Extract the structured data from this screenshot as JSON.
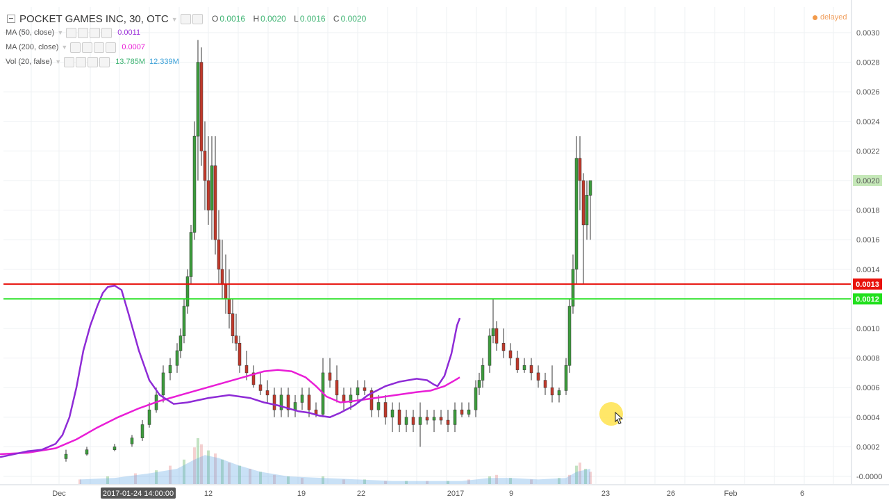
{
  "header": {
    "symbol_title": "POCKET GAMES INC, 30, OTC",
    "ohlc": {
      "o_label": "O",
      "o_value": "0.0016",
      "h_label": "H",
      "h_value": "0.0020",
      "l_label": "L",
      "l_value": "0.0016",
      "c_label": "C",
      "c_value": "0.0020"
    },
    "status": "delayed"
  },
  "indicators": {
    "ma50": {
      "label": "MA (50, close)",
      "value": "0.0011"
    },
    "ma200": {
      "label": "MA (200, close)",
      "value": "0.0007"
    },
    "volume": {
      "label": "Vol (20, false)",
      "value1": "13.785M",
      "value2": "12.339M"
    }
  },
  "chart_data": {
    "type": "candlestick",
    "x_tick_labels": [
      "Dec",
      "12",
      "19",
      "22",
      "2017",
      "9",
      "23",
      "26",
      "Feb",
      "6"
    ],
    "crosshair_x_label": "2017-01-24 14:00:00",
    "y_tick_labels": [
      "0.0030",
      "0.0028",
      "0.0026",
      "0.0024",
      "0.0022",
      "0.0020",
      "0.0018",
      "0.0016",
      "0.0014",
      "0.0010",
      "0.0008",
      "0.0006",
      "0.0004",
      "0.0002",
      "-0.0000"
    ],
    "ylim": [
      0.0,
      0.0031
    ],
    "last_price_label": "0.0020",
    "horizontal_lines": [
      {
        "name": "resistance",
        "value": 0.0013,
        "label": "0.0013",
        "color": "#e8120c"
      },
      {
        "name": "support",
        "value": 0.0012,
        "label": "0.0012",
        "color": "#22e01e"
      }
    ],
    "ma50_path": [
      [
        0,
        0.00013
      ],
      [
        20,
        0.00015
      ],
      [
        40,
        0.00017
      ],
      [
        60,
        0.00018
      ],
      [
        80,
        0.00022
      ],
      [
        90,
        0.00028
      ],
      [
        100,
        0.0004
      ],
      [
        110,
        0.0006
      ],
      [
        120,
        0.00085
      ],
      [
        130,
        0.00102
      ],
      [
        140,
        0.00115
      ],
      [
        148,
        0.00124
      ],
      [
        155,
        0.00128
      ],
      [
        165,
        0.00129
      ],
      [
        175,
        0.00126
      ],
      [
        185,
        0.0011
      ],
      [
        200,
        0.00085
      ],
      [
        215,
        0.00065
      ],
      [
        230,
        0.00055
      ],
      [
        250,
        0.00049
      ],
      [
        270,
        0.0005
      ],
      [
        300,
        0.00053
      ],
      [
        330,
        0.00055
      ],
      [
        360,
        0.00053
      ],
      [
        380,
        0.0005
      ],
      [
        400,
        0.00048
      ],
      [
        430,
        0.00044
      ],
      [
        445,
        0.00043
      ],
      [
        460,
        0.00041
      ],
      [
        475,
        0.0004
      ],
      [
        490,
        0.00043
      ],
      [
        510,
        0.00048
      ],
      [
        530,
        0.00055
      ],
      [
        555,
        0.00061
      ],
      [
        575,
        0.00064
      ],
      [
        600,
        0.00066
      ],
      [
        615,
        0.00065
      ],
      [
        625,
        0.00062
      ],
      [
        630,
        0.00061
      ],
      [
        640,
        0.00068
      ],
      [
        650,
        0.00083
      ],
      [
        658,
        0.00102
      ],
      [
        662,
        0.00107
      ]
    ],
    "ma200_path": [
      [
        0,
        0.00015
      ],
      [
        40,
        0.00016
      ],
      [
        80,
        0.00019
      ],
      [
        110,
        0.00025
      ],
      [
        140,
        0.00033
      ],
      [
        170,
        0.0004
      ],
      [
        200,
        0.00046
      ],
      [
        230,
        0.00051
      ],
      [
        260,
        0.00055
      ],
      [
        290,
        0.00059
      ],
      [
        320,
        0.00063
      ],
      [
        350,
        0.00067
      ],
      [
        380,
        0.00071
      ],
      [
        400,
        0.00072
      ],
      [
        420,
        0.00071
      ],
      [
        440,
        0.00067
      ],
      [
        455,
        0.00061
      ],
      [
        470,
        0.00054
      ],
      [
        490,
        0.0005
      ],
      [
        510,
        0.00051
      ],
      [
        540,
        0.00053
      ],
      [
        570,
        0.00055
      ],
      [
        600,
        0.00057
      ],
      [
        620,
        0.00058
      ],
      [
        640,
        0.00061
      ],
      [
        655,
        0.00065
      ],
      [
        662,
        0.00067
      ]
    ],
    "candles": [
      [
        -20,
        0.00012,
        0.00018,
        0.0001,
        0.00015
      ],
      [
        10,
        0.00015,
        0.0002,
        0.00014,
        0.00018
      ],
      [
        50,
        0.00018,
        0.00022,
        0.00017,
        0.0002
      ],
      [
        75,
        0.00022,
        0.00028,
        0.0002,
        0.00026
      ],
      [
        90,
        0.00026,
        0.00038,
        0.00024,
        0.00035
      ],
      [
        100,
        0.00035,
        0.0005,
        0.00033,
        0.00045
      ],
      [
        110,
        0.00045,
        0.0006,
        0.00043,
        0.00055
      ],
      [
        120,
        0.00055,
        0.00075,
        0.0005,
        0.0007
      ],
      [
        130,
        0.0007,
        0.0008,
        0.00065,
        0.00075
      ],
      [
        140,
        0.00075,
        0.0009,
        0.0007,
        0.00085
      ],
      [
        145,
        0.00085,
        0.001,
        0.0008,
        0.00095
      ],
      [
        150,
        0.00095,
        0.0012,
        0.0009,
        0.00115
      ],
      [
        155,
        0.00115,
        0.0014,
        0.0011,
        0.00135
      ],
      [
        160,
        0.00135,
        0.0017,
        0.0013,
        0.00165
      ],
      [
        165,
        0.00165,
        0.0024,
        0.0016,
        0.0023
      ],
      [
        170,
        0.0023,
        0.00295,
        0.002,
        0.0028
      ],
      [
        175,
        0.0028,
        0.0029,
        0.0021,
        0.0022
      ],
      [
        180,
        0.0022,
        0.0024,
        0.0018,
        0.002
      ],
      [
        185,
        0.002,
        0.0023,
        0.0017,
        0.0018
      ],
      [
        190,
        0.0018,
        0.0023,
        0.0016,
        0.0021
      ],
      [
        195,
        0.0021,
        0.0023,
        0.0015,
        0.0016
      ],
      [
        200,
        0.0016,
        0.0018,
        0.0013,
        0.0014
      ],
      [
        205,
        0.0014,
        0.0016,
        0.0012,
        0.0013
      ],
      [
        210,
        0.0013,
        0.0015,
        0.0011,
        0.0012
      ],
      [
        215,
        0.0012,
        0.0014,
        0.001,
        0.0011
      ],
      [
        220,
        0.0011,
        0.0012,
        0.0009,
        0.00095
      ],
      [
        225,
        0.00095,
        0.0011,
        0.00085,
        0.0009
      ],
      [
        230,
        0.0009,
        0.00095,
        0.0007,
        0.00075
      ],
      [
        240,
        0.00075,
        0.00085,
        0.00065,
        0.0007
      ],
      [
        250,
        0.0007,
        0.00075,
        0.0006,
        0.00062
      ],
      [
        260,
        0.00062,
        0.0007,
        0.00055,
        0.00058
      ],
      [
        270,
        0.00058,
        0.00065,
        0.0005,
        0.00055
      ],
      [
        280,
        0.00055,
        0.0006,
        0.0004,
        0.00045
      ],
      [
        290,
        0.00045,
        0.0006,
        0.0004,
        0.00055
      ],
      [
        300,
        0.00055,
        0.0006,
        0.0004,
        0.00045
      ],
      [
        310,
        0.00045,
        0.00055,
        0.0004,
        0.0005
      ],
      [
        320,
        0.0005,
        0.0006,
        0.00045,
        0.00055
      ],
      [
        330,
        0.00055,
        0.0006,
        0.0004,
        0.00045
      ],
      [
        340,
        0.00045,
        0.0005,
        0.0004,
        0.00042
      ],
      [
        350,
        0.00042,
        0.0008,
        0.0004,
        0.0007
      ],
      [
        360,
        0.0007,
        0.0008,
        0.0006,
        0.00065
      ],
      [
        370,
        0.00065,
        0.00075,
        0.0005,
        0.00055
      ],
      [
        380,
        0.00055,
        0.0006,
        0.00045,
        0.0005
      ],
      [
        390,
        0.0005,
        0.0006,
        0.00045,
        0.00055
      ],
      [
        400,
        0.00055,
        0.00065,
        0.0005,
        0.0006
      ],
      [
        410,
        0.0006,
        0.00065,
        0.00055,
        0.00058
      ],
      [
        420,
        0.00058,
        0.0006,
        0.0004,
        0.00045
      ],
      [
        430,
        0.00045,
        0.00055,
        0.0004,
        0.0005
      ],
      [
        440,
        0.0005,
        0.00055,
        0.00035,
        0.0004
      ],
      [
        450,
        0.0004,
        0.0005,
        0.0003,
        0.00045
      ],
      [
        460,
        0.00045,
        0.0005,
        0.0003,
        0.00035
      ],
      [
        470,
        0.00035,
        0.00045,
        0.0003,
        0.0004
      ],
      [
        480,
        0.0004,
        0.00045,
        0.0003,
        0.00035
      ],
      [
        490,
        0.00035,
        0.0005,
        0.0002,
        0.0004
      ],
      [
        500,
        0.0004,
        0.00045,
        0.00035,
        0.00038
      ],
      [
        510,
        0.00038,
        0.00045,
        0.0003,
        0.0004
      ],
      [
        520,
        0.0004,
        0.00045,
        0.00035,
        0.00038
      ],
      [
        530,
        0.00038,
        0.00045,
        0.0003,
        0.00035
      ],
      [
        540,
        0.00035,
        0.0005,
        0.0003,
        0.00045
      ],
      [
        550,
        0.00045,
        0.0005,
        0.0004,
        0.00042
      ],
      [
        560,
        0.00042,
        0.0005,
        0.0004,
        0.00045
      ],
      [
        570,
        0.00045,
        0.00065,
        0.0004,
        0.0006
      ],
      [
        575,
        0.0006,
        0.0007,
        0.00055,
        0.00065
      ],
      [
        580,
        0.00065,
        0.0008,
        0.0006,
        0.00075
      ],
      [
        590,
        0.00075,
        0.001,
        0.0007,
        0.00095
      ],
      [
        595,
        0.00095,
        0.0012,
        0.0009,
        0.001
      ],
      [
        600,
        0.001,
        0.00105,
        0.00085,
        0.0009
      ],
      [
        610,
        0.0009,
        0.001,
        0.0008,
        0.00085
      ],
      [
        620,
        0.00085,
        0.0009,
        0.00075,
        0.0008
      ],
      [
        630,
        0.0008,
        0.00085,
        0.0007,
        0.00072
      ],
      [
        640,
        0.00072,
        0.0008,
        0.0007,
        0.00075
      ],
      [
        650,
        0.00075,
        0.0008,
        0.00065,
        0.0007
      ],
      [
        660,
        0.0007,
        0.00075,
        0.0006,
        0.00065
      ],
      [
        670,
        0.00065,
        0.0007,
        0.00055,
        0.0006
      ],
      [
        680,
        0.0006,
        0.00075,
        0.0005,
        0.00055
      ],
      [
        690,
        0.00055,
        0.0006,
        0.0005,
        0.00058
      ],
      [
        700,
        0.00058,
        0.0008,
        0.00055,
        0.00075
      ],
      [
        705,
        0.00075,
        0.0012,
        0.0007,
        0.00115
      ],
      [
        710,
        0.00115,
        0.0015,
        0.0011,
        0.0014
      ],
      [
        715,
        0.0014,
        0.0023,
        0.0013,
        0.00215
      ],
      [
        720,
        0.00215,
        0.0023,
        0.0018,
        0.002
      ],
      [
        725,
        0.002,
        0.00205,
        0.0013,
        0.0017
      ],
      [
        730,
        0.0017,
        0.002,
        0.0016,
        0.0019
      ],
      [
        735,
        0.0019,
        0.002,
        0.0016,
        0.002
      ]
    ],
    "volume": [
      [
        0,
        0.3
      ],
      [
        40,
        0.5
      ],
      [
        80,
        0.7
      ],
      [
        110,
        0.9
      ],
      [
        130,
        1.2
      ],
      [
        150,
        1.6
      ],
      [
        165,
        2.4
      ],
      [
        170,
        3.0
      ],
      [
        175,
        2.6
      ],
      [
        185,
        2.2
      ],
      [
        195,
        2.0
      ],
      [
        205,
        1.6
      ],
      [
        215,
        1.4
      ],
      [
        230,
        1.2
      ],
      [
        245,
        1.0
      ],
      [
        260,
        0.8
      ],
      [
        280,
        0.6
      ],
      [
        300,
        0.5
      ],
      [
        320,
        0.4
      ],
      [
        350,
        0.5
      ],
      [
        380,
        0.3
      ],
      [
        410,
        0.3
      ],
      [
        440,
        0.2
      ],
      [
        470,
        0.2
      ],
      [
        500,
        0.2
      ],
      [
        530,
        0.2
      ],
      [
        560,
        0.3
      ],
      [
        590,
        0.5
      ],
      [
        600,
        0.6
      ],
      [
        620,
        0.4
      ],
      [
        650,
        0.3
      ],
      [
        690,
        0.4
      ],
      [
        705,
        0.6
      ],
      [
        715,
        1.2
      ],
      [
        720,
        1.4
      ],
      [
        728,
        1.0
      ],
      [
        735,
        0.8
      ]
    ],
    "volume_ma": [
      [
        0,
        0.3
      ],
      [
        50,
        0.4
      ],
      [
        100,
        0.7
      ],
      [
        140,
        1.0
      ],
      [
        165,
        1.6
      ],
      [
        180,
        1.9
      ],
      [
        200,
        1.7
      ],
      [
        230,
        1.2
      ],
      [
        260,
        0.8
      ],
      [
        300,
        0.5
      ],
      [
        350,
        0.4
      ],
      [
        400,
        0.3
      ],
      [
        450,
        0.2
      ],
      [
        500,
        0.2
      ],
      [
        550,
        0.2
      ],
      [
        590,
        0.4
      ],
      [
        620,
        0.4
      ],
      [
        660,
        0.3
      ],
      [
        700,
        0.4
      ],
      [
        715,
        0.8
      ],
      [
        735,
        1.0
      ]
    ]
  }
}
